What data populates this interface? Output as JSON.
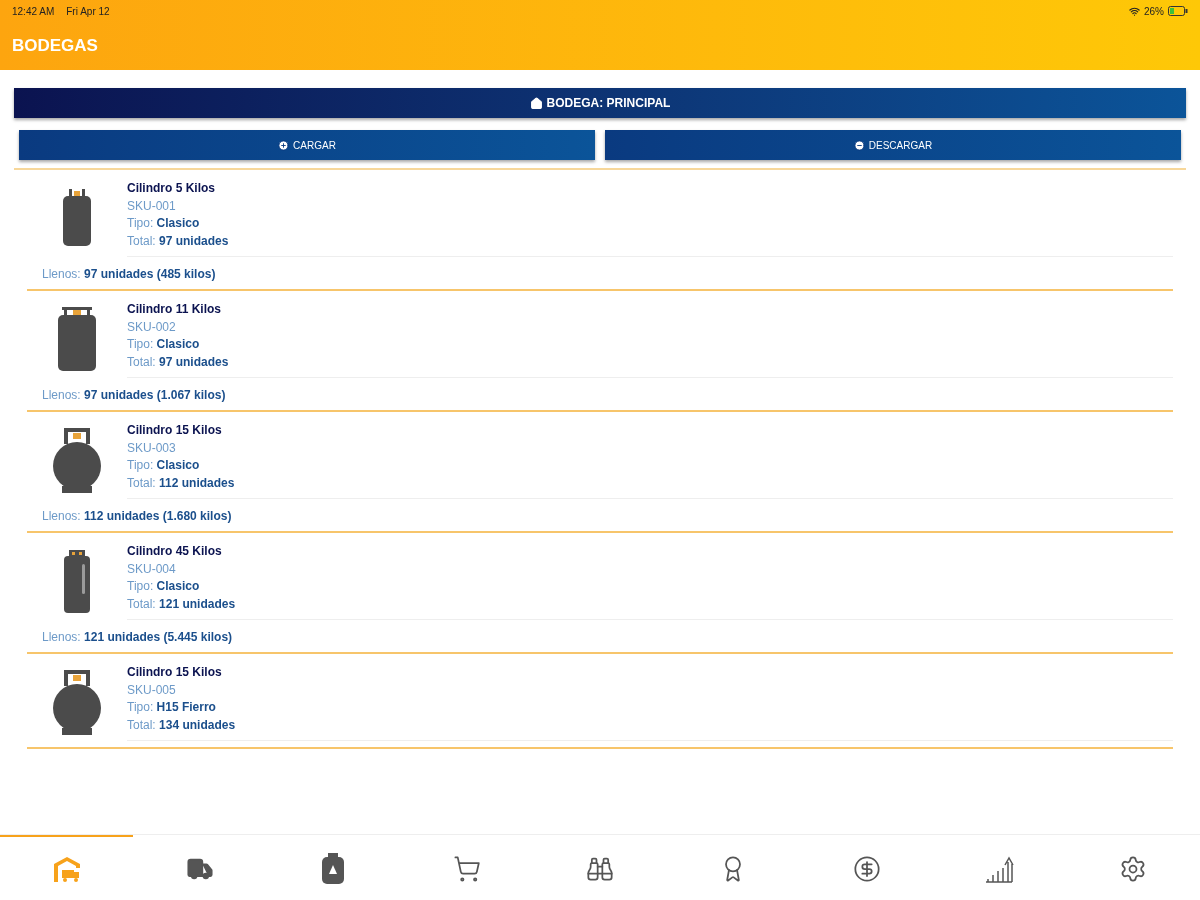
{
  "status_bar": {
    "time": "12:42 AM",
    "date": "Fri Apr 12",
    "battery": "26%"
  },
  "header": {
    "title": "BODEGAS"
  },
  "warehouse_button": {
    "label": "BODEGA: PRINCIPAL"
  },
  "actions": [
    {
      "label": "CARGAR",
      "kind": "add"
    },
    {
      "label": "DESCARGAR",
      "kind": "remove"
    }
  ],
  "products": [
    {
      "kind": "small",
      "name": "Cilindro 5 Kilos",
      "sku": "SKU-001",
      "type_label": "Tipo:",
      "type": "Clasico",
      "total_label": "Total:",
      "total": "97 unidades",
      "full_label": "Llenos:",
      "full": "97 unidades (485 kilos)"
    },
    {
      "kind": "medium",
      "name": "Cilindro 11 Kilos",
      "sku": "SKU-002",
      "type_label": "Tipo:",
      "type": "Clasico",
      "total_label": "Total:",
      "total": "97 unidades",
      "full_label": "Llenos:",
      "full": "97 unidades (1.067 kilos)"
    },
    {
      "kind": "round",
      "name": "Cilindro 15 Kilos",
      "sku": "SKU-003",
      "type_label": "Tipo:",
      "type": "Clasico",
      "total_label": "Total:",
      "total": "112 unidades",
      "full_label": "Llenos:",
      "full": "112 unidades (1.680 kilos)"
    },
    {
      "kind": "tall",
      "name": "Cilindro 45 Kilos",
      "sku": "SKU-004",
      "type_label": "Tipo:",
      "type": "Clasico",
      "total_label": "Total:",
      "total": "121 unidades",
      "full_label": "Llenos:",
      "full": "121 unidades (5.445 kilos)"
    },
    {
      "kind": "round",
      "name": "Cilindro 15 Kilos",
      "sku": "SKU-005",
      "type_label": "Tipo:",
      "type": "H15 Fierro",
      "total_label": "Total:",
      "total": "134 unidades"
    }
  ],
  "tabs": [
    {
      "kind": "warehouse",
      "selected": true
    },
    {
      "kind": "truck",
      "selected": false
    },
    {
      "kind": "cylinder",
      "selected": false
    },
    {
      "kind": "cart",
      "selected": false
    },
    {
      "kind": "binoculars",
      "selected": false
    },
    {
      "kind": "award",
      "selected": false
    },
    {
      "kind": "dollar",
      "selected": false
    },
    {
      "kind": "growth",
      "selected": false
    },
    {
      "kind": "settings",
      "selected": false
    }
  ]
}
